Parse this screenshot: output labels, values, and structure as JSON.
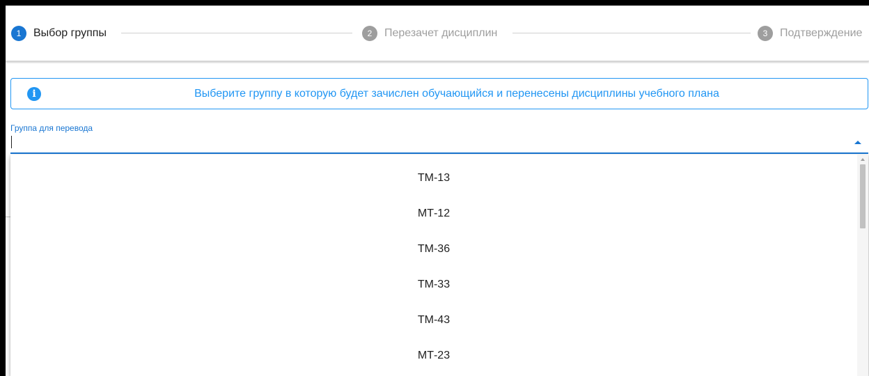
{
  "stepper": {
    "steps": [
      {
        "num": "1",
        "label": "Выбор группы",
        "color": "#1976d2"
      },
      {
        "num": "2",
        "label": "Перезачет дисциплин",
        "color": "#9e9e9e"
      },
      {
        "num": "3",
        "label": "Подтверждение",
        "color": "#9e9e9e"
      }
    ]
  },
  "alert": {
    "icon": "info-icon",
    "text": "Выберите группу в которую будет зачислен обучающийся и перенесены дисциплины учебного плана"
  },
  "group_select": {
    "label": "Группа для перевода",
    "value": "",
    "expanded": true,
    "options": [
      "ТМ-13",
      "МТ-12",
      "ТМ-36",
      "ТМ-33",
      "ТМ-43",
      "МТ-23"
    ]
  },
  "colors": {
    "primary": "#1976d2",
    "info": "#2196f3",
    "inactive": "#9e9e9e"
  }
}
